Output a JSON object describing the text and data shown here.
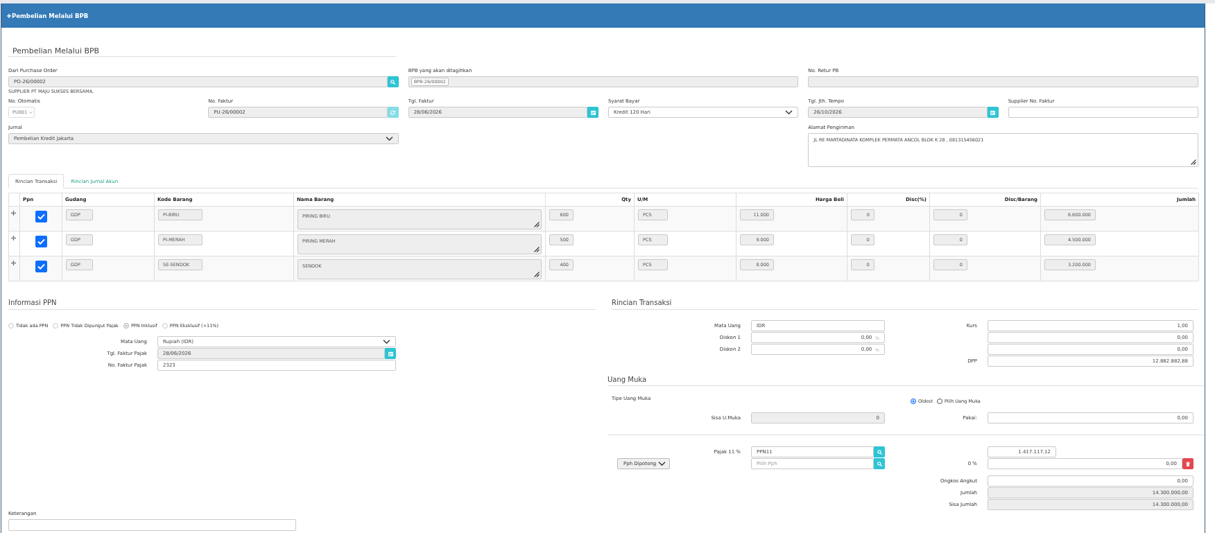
{
  "header": {
    "title": "Pembelian Melalui BPB"
  },
  "form": {
    "title": "Pembelian Melalui BPB",
    "purchase_order": {
      "label": "Dari Purchase Order",
      "value": "PO-26/00002",
      "disabled": true,
      "button_disabled": false,
      "note": "SUPPLIER PT MAJU SUKSES BERSAMA,"
    },
    "bpb": {
      "label": "BPB yang akan ditagihkan",
      "tags": [
        "BPB-26/00002"
      ],
      "disabled": true
    },
    "return_number": {
      "label": "No. Retur PB",
      "disabled": true
    },
    "auto_number": {
      "label": "No. Otomatis",
      "value": "PU001"
    },
    "invoice_number": {
      "label": "No. Faktur",
      "value": "PU-26/00002",
      "disabled": true,
      "button_disabled": true
    },
    "invoice_date": {
      "label": "Tgl. Faktur",
      "value": "28/06/2026",
      "disabled": true,
      "button_disabled": false
    },
    "payment_terms": {
      "label": "Syarat Bayar",
      "value": "Kredit 120 Hari",
      "disabled": false
    },
    "due_date": {
      "label": "Tgl. Jth. Tempo",
      "value": "26/10/2026",
      "disabled": true,
      "button_disabled": false
    },
    "supplier_invoice": {
      "label": "Supplier No. Faktur",
      "disabled": false
    },
    "journal": {
      "label": "Jurnal",
      "value": "Pembelian Kredit Jakarta",
      "disabled": true
    },
    "shipping_address": {
      "label": "Alamat Pengiriman",
      "value": "JL RE MARTADINATA KOMPLEK PERMATA ANCOL BLOK K 28 , 081315456021",
      "disabled": false
    }
  },
  "tabs": [
    {
      "label": "Rincian Transaksi",
      "selected": true
    },
    {
      "label": "Rincian Jurnal Akun",
      "selected": false
    }
  ],
  "table": {
    "columns": [
      "Ppn",
      "Gudang",
      "Kode Barang",
      "Nama Barang",
      "Qty",
      "U/M",
      "Harga Beli",
      "Disc(%)",
      "Disc/Barang",
      "Jumlah"
    ],
    "rows": [
      {
        "cells": [
          {
            "kind": "checkbox",
            "checked": true
          },
          {
            "kind": "text",
            "value": "GDP"
          },
          {
            "kind": "text",
            "value": "PI-BIRU"
          },
          {
            "kind": "textarea",
            "value": "PIRING BIRU"
          },
          {
            "kind": "number",
            "value": "600"
          },
          {
            "kind": "text",
            "value": "PCS"
          },
          {
            "kind": "number",
            "value": "11.000"
          },
          {
            "kind": "number",
            "value": "0"
          },
          {
            "kind": "number",
            "value": "0"
          },
          {
            "kind": "number",
            "value": "6.600.000"
          }
        ]
      },
      {
        "cells": [
          {
            "kind": "checkbox",
            "checked": true
          },
          {
            "kind": "text",
            "value": "GDP"
          },
          {
            "kind": "text",
            "value": "PI-MERAH"
          },
          {
            "kind": "textarea",
            "value": "PIRING MERAH"
          },
          {
            "kind": "number",
            "value": "500"
          },
          {
            "kind": "text",
            "value": "PCS"
          },
          {
            "kind": "number",
            "value": "9.000"
          },
          {
            "kind": "number",
            "value": "0"
          },
          {
            "kind": "number",
            "value": "0"
          },
          {
            "kind": "number",
            "value": "4.500.000"
          }
        ]
      },
      {
        "cells": [
          {
            "kind": "checkbox",
            "checked": true
          },
          {
            "kind": "text",
            "value": "GDP"
          },
          {
            "kind": "text",
            "value": "SE-SENDOK"
          },
          {
            "kind": "textarea",
            "value": "SENDOK"
          },
          {
            "kind": "number",
            "value": "400"
          },
          {
            "kind": "text",
            "value": "PCS"
          },
          {
            "kind": "number",
            "value": "8.000"
          },
          {
            "kind": "number",
            "value": "0"
          },
          {
            "kind": "number",
            "value": "0"
          },
          {
            "kind": "number",
            "value": "3.200.000"
          }
        ]
      }
    ]
  },
  "ppn_info": {
    "title": "Informasi PPN",
    "options": [
      {
        "label": "Tidak ada PPN",
        "selected": false,
        "disabled": true
      },
      {
        "label": "PPN Tidak Dipungut Pajak",
        "selected": false,
        "disabled": true
      },
      {
        "label": "PPN Inklusif",
        "selected": true,
        "disabled": true
      },
      {
        "label": "PPN Eksklusif (+11%)",
        "selected": false,
        "disabled": true
      }
    ],
    "fields": [
      {
        "kind": "select",
        "label": "Mata Uang",
        "value": "Rupiah (IDR)",
        "disabled": false
      },
      {
        "kind": "date",
        "label": "Tgl. Faktur Pajak",
        "value": "28/06/2026",
        "disabled": true
      },
      {
        "kind": "text",
        "label": "No. Faktur Pajak",
        "value": "2323",
        "disabled": false
      }
    ]
  },
  "notes": {
    "label": "Keterangan"
  },
  "summary": {
    "title": "Rincian Transaksi",
    "left": [
      {
        "kind": "text",
        "label": "Mata Uang",
        "value": "IDR"
      },
      {
        "kind": "number",
        "label": "Diskon 1",
        "value": "0,00",
        "suffix": "%"
      },
      {
        "kind": "number",
        "label": "Diskon 2",
        "value": "0,00",
        "suffix": "%"
      }
    ],
    "right": [
      {
        "kind": "number",
        "label": "Kurs",
        "value": "1,00"
      },
      {
        "kind": "number",
        "value": "0,00"
      },
      {
        "kind": "number",
        "value": "0,00"
      },
      {
        "kind": "number",
        "label": "DPP",
        "value": "12.882.882,88"
      }
    ]
  },
  "down_payment": {
    "title": "Uang Muka",
    "type_label": "Tipe Uang Muka",
    "options": [
      {
        "label": "Oldest",
        "selected": true
      },
      {
        "label": "Pilih Uang Muka",
        "selected": false
      }
    ],
    "remaining": {
      "label": "Sisa U.Muka",
      "value": "0",
      "disabled": true
    },
    "used": {
      "label": "Pakai:",
      "value": "0,00",
      "disabled": false
    }
  },
  "tax": {
    "rows": [
      {
        "label": "Pajak 11 %",
        "field": {
          "value": "PPN11"
        }
      },
      {
        "select": {
          "value": "Pph Dipotong"
        },
        "field": {
          "placeholder": "Pilih Pph"
        }
      }
    ],
    "amounts": [
      {
        "kind": "short",
        "value": "1.417.117,12"
      },
      {
        "kind": "removable",
        "label": "0 %",
        "value": "0,00"
      }
    ]
  },
  "totals": [
    {
      "label": "Ongkos Angkut",
      "value": "0,00",
      "disabled": false
    },
    {
      "label": "Jumlah",
      "value": "14.300.000,00",
      "disabled": true
    },
    {
      "label": "Sisa Jumlah",
      "value": "14.300.000,00",
      "disabled": true
    }
  ]
}
